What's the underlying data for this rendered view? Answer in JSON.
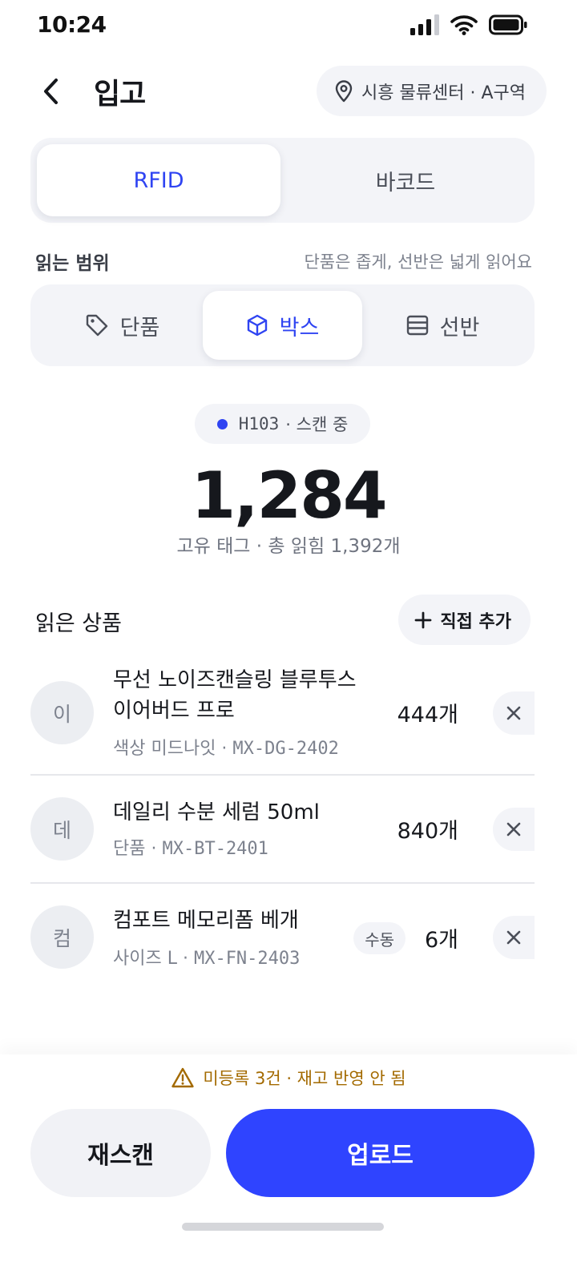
{
  "status_bar": {
    "time": "10:24"
  },
  "header": {
    "title": "입고",
    "location": "시흥 물류센터 · A구역"
  },
  "mode_tabs": {
    "rfid": "RFID",
    "barcode": "바코드"
  },
  "range": {
    "label": "읽는 범위",
    "hint": "단품은 좁게, 선반은 넓게 읽어요",
    "options": {
      "item": "단품",
      "box": "박스",
      "shelf": "선반"
    },
    "selected": "박스"
  },
  "scan": {
    "code": "H103",
    "status": "· 스캔 중",
    "count": "1,284",
    "summary": "고유 태그 · 총 읽힘 1,392개"
  },
  "list": {
    "title": "읽은 상품",
    "add_label": "직접 추가",
    "products": [
      {
        "avatar": "이",
        "name_line1": "무선 노이즈캔슬링 블루투스",
        "name_line2": "이어버드 프로",
        "meta_prefix": "색상 미드나잇 · ",
        "sku": "MX-DG-2402",
        "qty": "444개"
      },
      {
        "avatar": "데",
        "name_line1": "데일리 수분 세럼 50ml",
        "meta_prefix": "단품 · ",
        "sku": "MX-BT-2401",
        "qty": "840개"
      },
      {
        "avatar": "컴",
        "name_line1": "컴포트 메모리폼 베개",
        "meta_prefix": "사이즈 L · ",
        "sku": "MX-FN-2403",
        "qty": "6개",
        "badge": "수동"
      }
    ]
  },
  "footer": {
    "warning": "미등록 3건 · 재고 반영 안 됨",
    "rescan": "재스캔",
    "upload": "업로드"
  },
  "colors": {
    "accent": "#2f44ff",
    "warning": "#a36a00",
    "chip_bg": "#f3f4f8"
  }
}
